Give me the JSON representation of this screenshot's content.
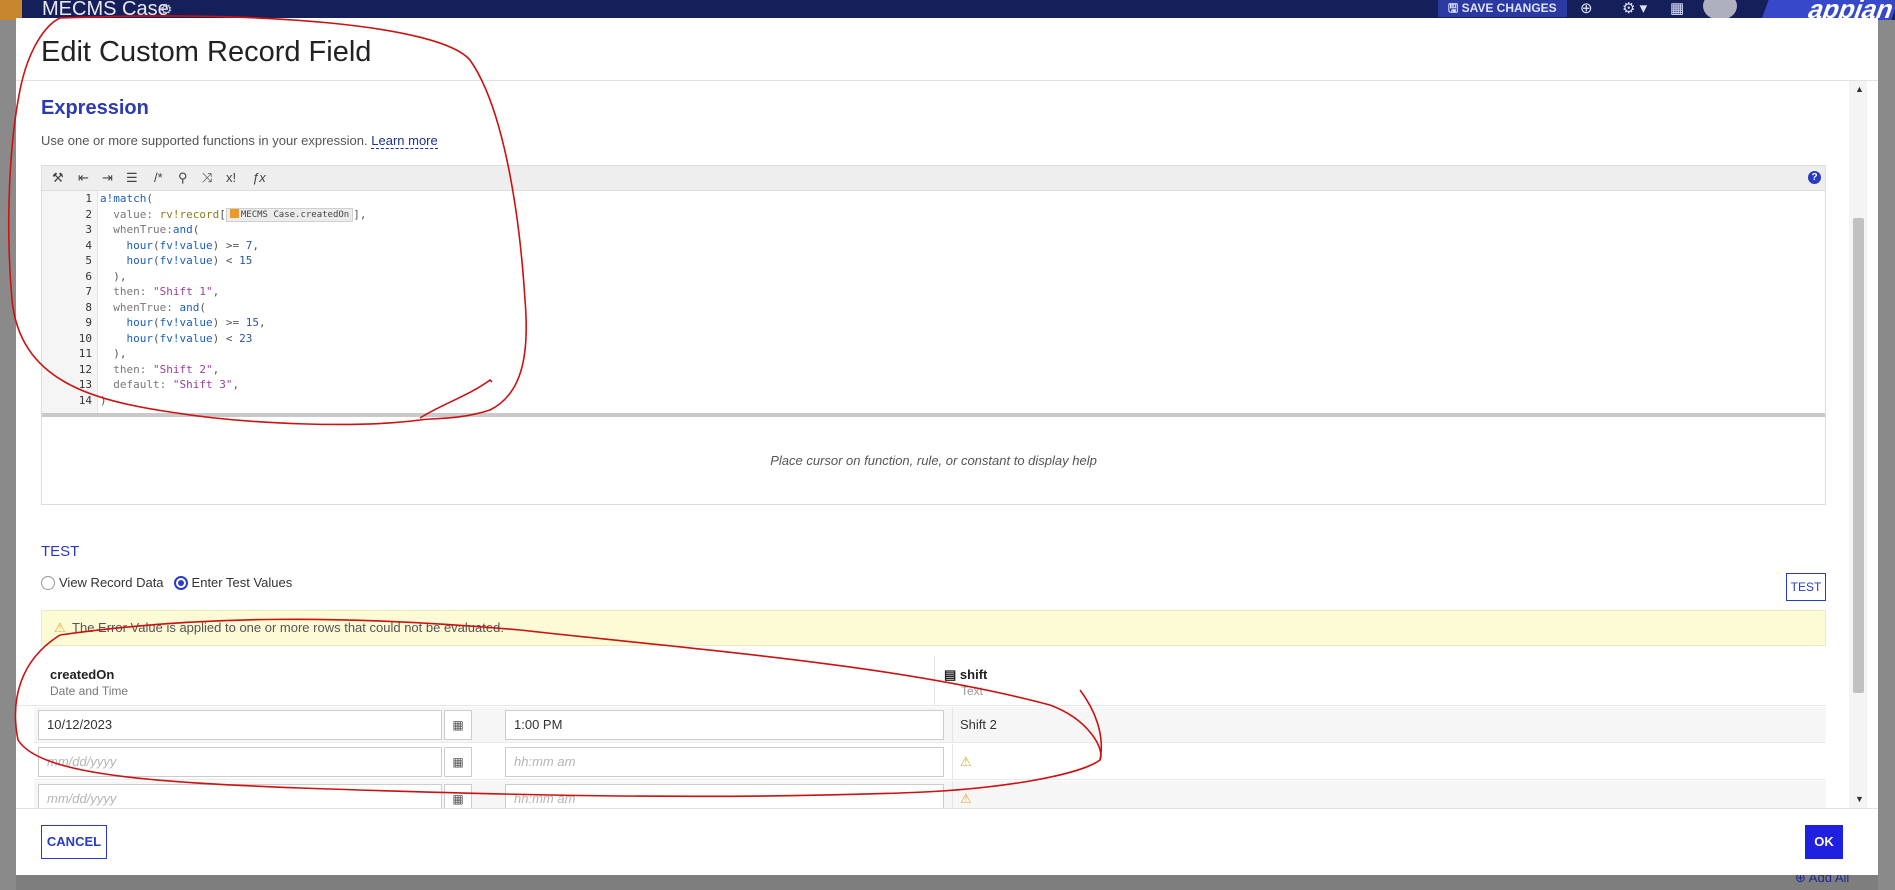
{
  "appbar": {
    "title": "MECMS Case",
    "save_label": "SAVE CHANGES",
    "brand": "appian"
  },
  "background": {
    "add_all_label": "Add All"
  },
  "modal": {
    "title": "Edit Custom Record Field",
    "expression": {
      "title": "Expression",
      "description": "Use one or more supported functions in your expression.",
      "learn_more": "Learn more",
      "help_placeholder": "Place cursor on function, rule, or constant to display help",
      "toolbar_icons": [
        "magic-wand-icon",
        "outdent-icon",
        "indent-icon",
        "list-icon",
        "comment-icon",
        "search-icon",
        "shuffle-icon",
        "exclamation-icon",
        "function-icon"
      ],
      "line_numbers": [
        "1",
        "2",
        "3",
        "4",
        "5",
        "6",
        "7",
        "8",
        "9",
        "10",
        "11",
        "12",
        "13",
        "14"
      ],
      "token_label": "MECMS Case.createdOn"
    },
    "test": {
      "title": "TEST",
      "radio_view": "View Record Data",
      "radio_enter": "Enter Test Values",
      "test_button": "TEST",
      "warning": "The Error Value is applied to one or more rows that could not be evaluated.",
      "col1_name": "createdOn",
      "col1_type": "Date and Time",
      "col2_name": "shift",
      "col2_type": "Text",
      "rows": [
        {
          "date": "10/12/2023",
          "time": "1:00 PM",
          "result": "Shift 2"
        },
        {
          "date_placeholder": "mm/dd/yyyy",
          "time_placeholder": "hh:mm am",
          "result": "⚠"
        },
        {
          "date_placeholder": "mm/dd/yyyy",
          "time_placeholder": "hh:mm am",
          "result": "⚠"
        }
      ]
    },
    "cancel_label": "CANCEL",
    "ok_label": "OK"
  },
  "colors": {
    "accent": "#2a3bc4",
    "appbar": "#15205a",
    "warning_bg": "#fcfbd6",
    "annotation": "#cc1111"
  }
}
